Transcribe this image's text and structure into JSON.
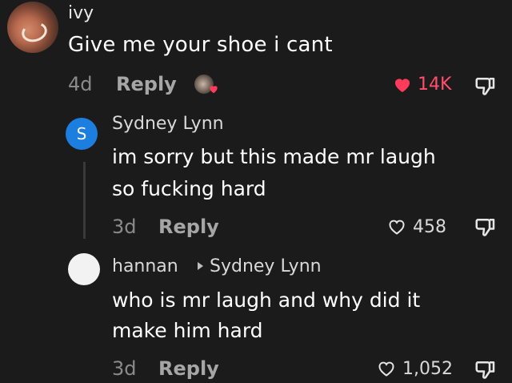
{
  "parent_comment": {
    "username": "ivy",
    "text": "Give me your shoe i cant",
    "age": "4d",
    "reply_label": "Reply",
    "likes": "14K",
    "liked": true,
    "like_color": "#ff3b5c"
  },
  "replies": [
    {
      "avatar_letter": "S",
      "avatar_color": "#1c7fe0",
      "username": "Sydney Lynn",
      "text_line1": "im sorry but this made mr laugh",
      "text_line2": "so fucking hard",
      "age": "3d",
      "reply_label": "Reply",
      "likes": "458"
    },
    {
      "avatar_color": "#f2f2f2",
      "username": "hannan",
      "reply_to": "Sydney Lynn",
      "text_line1": "who is mr laugh and why did it",
      "text_line2": "make him hard",
      "age": "3d",
      "reply_label": "Reply",
      "likes": "1,052"
    }
  ],
  "icons": {
    "like": "heart-icon",
    "dislike": "thumbs-down-icon",
    "creator_liked": "creator-liked-avatar-icon",
    "reply_to": "triangle-right-icon"
  }
}
